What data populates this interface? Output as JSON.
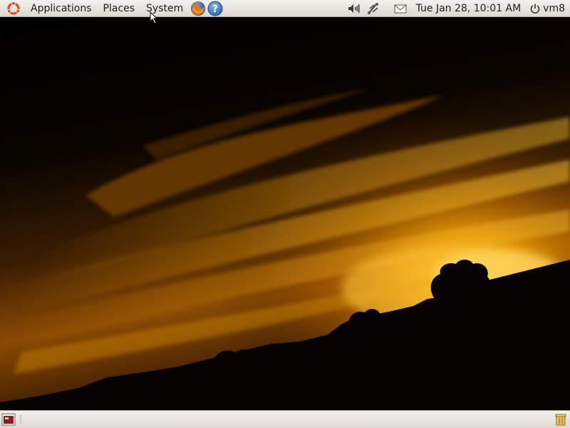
{
  "top_panel": {
    "menus": {
      "applications": "Applications",
      "places": "Places",
      "system": "System"
    },
    "launchers": [
      "firefox-icon",
      "help-icon"
    ],
    "tray": [
      "volume-icon",
      "network-icon",
      "mail-icon"
    ],
    "clock": "Tue Jan 28, 10:01 AM",
    "user": "vm8"
  },
  "bottom_panel": {
    "icons": [
      "show-desktop-icon",
      "trash-icon"
    ]
  },
  "colors": {
    "panel": "#e8e5df",
    "sunset_orange": "#f0a000",
    "sky_dark": "#000000"
  }
}
